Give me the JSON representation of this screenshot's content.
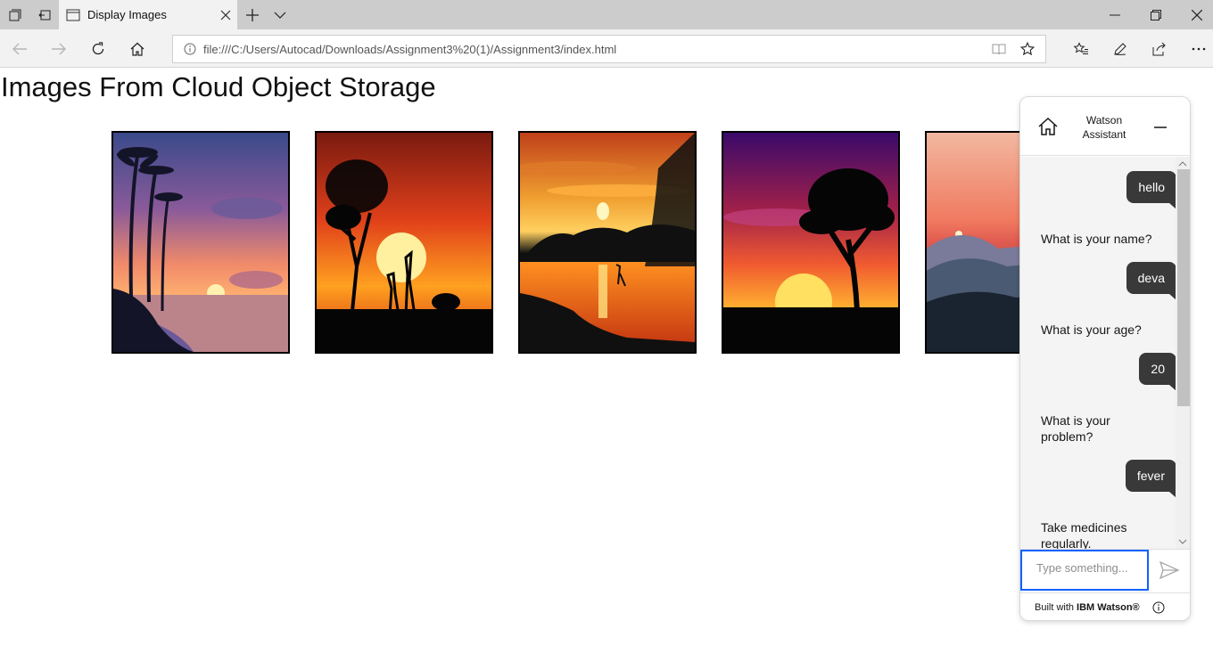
{
  "browser": {
    "tab_title": "Display Images",
    "url": "file:///C:/Users/Autocad/Downloads/Assignment3%20(1)/Assignment3/index.html"
  },
  "page": {
    "title": "Images From Cloud Object Storage",
    "images": [
      {
        "subject": "tropical beach sunset with palm trees"
      },
      {
        "subject": "safari sunset with tree and giraffes"
      },
      {
        "subject": "lake sunset with heron"
      },
      {
        "subject": "purple sunset with lone tree"
      },
      {
        "subject": "mountain sunrise"
      }
    ]
  },
  "watson": {
    "title_line1": "Watson",
    "title_line2": "Assistant",
    "messages": [
      {
        "from": "user",
        "text": "hello"
      },
      {
        "from": "bot",
        "text": "What is your name?"
      },
      {
        "from": "user",
        "text": "deva"
      },
      {
        "from": "bot",
        "text": "What is your age?"
      },
      {
        "from": "user",
        "text": "20"
      },
      {
        "from": "bot",
        "text": "What is your problem?"
      },
      {
        "from": "user",
        "text": "fever"
      },
      {
        "from": "bot",
        "text": "Take medicines regularly."
      }
    ],
    "help_label": "?",
    "input_placeholder": "Type something...",
    "footer_prefix": "Built with",
    "footer_brand": "IBM Watson®",
    "accent_color": "#0f62fe",
    "user_bubble_color": "#393939"
  }
}
